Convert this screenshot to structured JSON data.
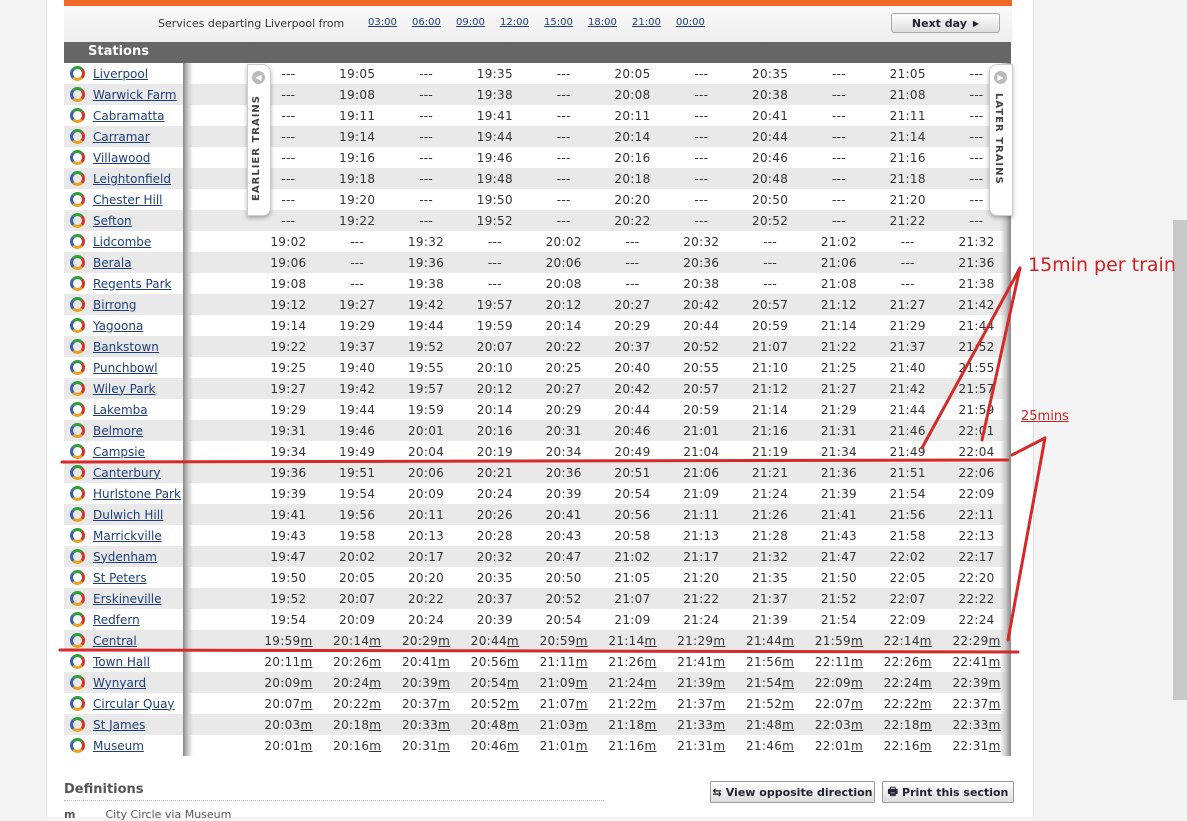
{
  "departure_bar": {
    "label": "Services departing Liverpool from",
    "times": [
      "03:00",
      "06:00",
      "09:00",
      "12:00",
      "15:00",
      "18:00",
      "21:00",
      "00:00"
    ],
    "next_day_label": "Next day"
  },
  "table": {
    "header": "Stations",
    "earlier_label": "EARLIER TRAINS",
    "later_label": "LATER TRAINS",
    "rows": [
      {
        "station": "Liverpool",
        "times": [
          "---",
          "19:05",
          "---",
          "19:35",
          "---",
          "20:05",
          "---",
          "20:35",
          "---",
          "21:05",
          "---"
        ]
      },
      {
        "station": "Warwick Farm",
        "times": [
          "---",
          "19:08",
          "---",
          "19:38",
          "---",
          "20:08",
          "---",
          "20:38",
          "---",
          "21:08",
          "---"
        ]
      },
      {
        "station": "Cabramatta",
        "times": [
          "---",
          "19:11",
          "---",
          "19:41",
          "---",
          "20:11",
          "---",
          "20:41",
          "---",
          "21:11",
          "---"
        ]
      },
      {
        "station": "Carramar",
        "times": [
          "---",
          "19:14",
          "---",
          "19:44",
          "---",
          "20:14",
          "---",
          "20:44",
          "---",
          "21:14",
          "---"
        ]
      },
      {
        "station": "Villawood",
        "times": [
          "---",
          "19:16",
          "---",
          "19:46",
          "---",
          "20:16",
          "---",
          "20:46",
          "---",
          "21:16",
          "---"
        ]
      },
      {
        "station": "Leightonfield",
        "times": [
          "---",
          "19:18",
          "---",
          "19:48",
          "---",
          "20:18",
          "---",
          "20:48",
          "---",
          "21:18",
          "---"
        ]
      },
      {
        "station": "Chester Hill",
        "times": [
          "---",
          "19:20",
          "---",
          "19:50",
          "---",
          "20:20",
          "---",
          "20:50",
          "---",
          "21:20",
          "---"
        ]
      },
      {
        "station": "Sefton",
        "times": [
          "---",
          "19:22",
          "---",
          "19:52",
          "---",
          "20:22",
          "---",
          "20:52",
          "---",
          "21:22",
          "---"
        ]
      },
      {
        "station": "Lidcombe",
        "times": [
          "19:02",
          "---",
          "19:32",
          "---",
          "20:02",
          "---",
          "20:32",
          "---",
          "21:02",
          "---",
          "21:32"
        ]
      },
      {
        "station": "Berala",
        "times": [
          "19:06",
          "---",
          "19:36",
          "---",
          "20:06",
          "---",
          "20:36",
          "---",
          "21:06",
          "---",
          "21:36"
        ]
      },
      {
        "station": "Regents Park",
        "times": [
          "19:08",
          "---",
          "19:38",
          "---",
          "20:08",
          "---",
          "20:38",
          "---",
          "21:08",
          "---",
          "21:38"
        ]
      },
      {
        "station": "Birrong",
        "times": [
          "19:12",
          "19:27",
          "19:42",
          "19:57",
          "20:12",
          "20:27",
          "20:42",
          "20:57",
          "21:12",
          "21:27",
          "21:42"
        ]
      },
      {
        "station": "Yagoona",
        "times": [
          "19:14",
          "19:29",
          "19:44",
          "19:59",
          "20:14",
          "20:29",
          "20:44",
          "20:59",
          "21:14",
          "21:29",
          "21:44"
        ]
      },
      {
        "station": "Bankstown",
        "times": [
          "19:22",
          "19:37",
          "19:52",
          "20:07",
          "20:22",
          "20:37",
          "20:52",
          "21:07",
          "21:22",
          "21:37",
          "21:52"
        ]
      },
      {
        "station": "Punchbowl",
        "times": [
          "19:25",
          "19:40",
          "19:55",
          "20:10",
          "20:25",
          "20:40",
          "20:55",
          "21:10",
          "21:25",
          "21:40",
          "21:55"
        ]
      },
      {
        "station": "Wiley Park",
        "times": [
          "19:27",
          "19:42",
          "19:57",
          "20:12",
          "20:27",
          "20:42",
          "20:57",
          "21:12",
          "21:27",
          "21:42",
          "21:57"
        ]
      },
      {
        "station": "Lakemba",
        "times": [
          "19:29",
          "19:44",
          "19:59",
          "20:14",
          "20:29",
          "20:44",
          "20:59",
          "21:14",
          "21:29",
          "21:44",
          "21:59"
        ]
      },
      {
        "station": "Belmore",
        "times": [
          "19:31",
          "19:46",
          "20:01",
          "20:16",
          "20:31",
          "20:46",
          "21:01",
          "21:16",
          "21:31",
          "21:46",
          "22:01"
        ]
      },
      {
        "station": "Campsie",
        "times": [
          "19:34",
          "19:49",
          "20:04",
          "20:19",
          "20:34",
          "20:49",
          "21:04",
          "21:19",
          "21:34",
          "21:49",
          "22:04"
        ]
      },
      {
        "station": "Canterbury",
        "times": [
          "19:36",
          "19:51",
          "20:06",
          "20:21",
          "20:36",
          "20:51",
          "21:06",
          "21:21",
          "21:36",
          "21:51",
          "22:06"
        ]
      },
      {
        "station": "Hurlstone Park",
        "times": [
          "19:39",
          "19:54",
          "20:09",
          "20:24",
          "20:39",
          "20:54",
          "21:09",
          "21:24",
          "21:39",
          "21:54",
          "22:09"
        ]
      },
      {
        "station": "Dulwich Hill",
        "times": [
          "19:41",
          "19:56",
          "20:11",
          "20:26",
          "20:41",
          "20:56",
          "21:11",
          "21:26",
          "21:41",
          "21:56",
          "22:11"
        ]
      },
      {
        "station": "Marrickville",
        "times": [
          "19:43",
          "19:58",
          "20:13",
          "20:28",
          "20:43",
          "20:58",
          "21:13",
          "21:28",
          "21:43",
          "21:58",
          "22:13"
        ]
      },
      {
        "station": "Sydenham",
        "times": [
          "19:47",
          "20:02",
          "20:17",
          "20:32",
          "20:47",
          "21:02",
          "21:17",
          "21:32",
          "21:47",
          "22:02",
          "22:17"
        ]
      },
      {
        "station": "St Peters",
        "times": [
          "19:50",
          "20:05",
          "20:20",
          "20:35",
          "20:50",
          "21:05",
          "21:20",
          "21:35",
          "21:50",
          "22:05",
          "22:20"
        ]
      },
      {
        "station": "Erskineville",
        "times": [
          "19:52",
          "20:07",
          "20:22",
          "20:37",
          "20:52",
          "21:07",
          "21:22",
          "21:37",
          "21:52",
          "22:07",
          "22:22"
        ]
      },
      {
        "station": "Redfern",
        "times": [
          "19:54",
          "20:09",
          "20:24",
          "20:39",
          "20:54",
          "21:09",
          "21:24",
          "21:39",
          "21:54",
          "22:09",
          "22:24"
        ]
      },
      {
        "station": "Central",
        "times": [
          "19:59m",
          "20:14m",
          "20:29m",
          "20:44m",
          "20:59m",
          "21:14m",
          "21:29m",
          "21:44m",
          "21:59m",
          "22:14m",
          "22:29m"
        ]
      },
      {
        "station": "Town Hall",
        "times": [
          "20:11m",
          "20:26m",
          "20:41m",
          "20:56m",
          "21:11m",
          "21:26m",
          "21:41m",
          "21:56m",
          "22:11m",
          "22:26m",
          "22:41m"
        ]
      },
      {
        "station": "Wynyard",
        "times": [
          "20:09m",
          "20:24m",
          "20:39m",
          "20:54m",
          "21:09m",
          "21:24m",
          "21:39m",
          "21:54m",
          "22:09m",
          "22:24m",
          "22:39m"
        ]
      },
      {
        "station": "Circular Quay",
        "times": [
          "20:07m",
          "20:22m",
          "20:37m",
          "20:52m",
          "21:07m",
          "21:22m",
          "21:37m",
          "21:52m",
          "22:07m",
          "22:22m",
          "22:37m"
        ]
      },
      {
        "station": "St James",
        "times": [
          "20:03m",
          "20:18m",
          "20:33m",
          "20:48m",
          "21:03m",
          "21:18m",
          "21:33m",
          "21:48m",
          "22:03m",
          "22:18m",
          "22:33m"
        ]
      },
      {
        "station": "Museum",
        "times": [
          "20:01m",
          "20:16m",
          "20:31m",
          "20:46m",
          "21:01m",
          "21:16m",
          "21:31m",
          "21:46m",
          "22:01m",
          "22:16m",
          "22:31m"
        ]
      }
    ]
  },
  "definitions": {
    "title": "Definitions",
    "items": [
      {
        "code": "m",
        "text": "City Circle via Museum"
      }
    ]
  },
  "buttons": {
    "opposite": "View opposite direction",
    "print": "Print this section"
  },
  "annotations": {
    "note1": "15min per train",
    "note2": "25mins",
    "color": "#cc2222"
  }
}
